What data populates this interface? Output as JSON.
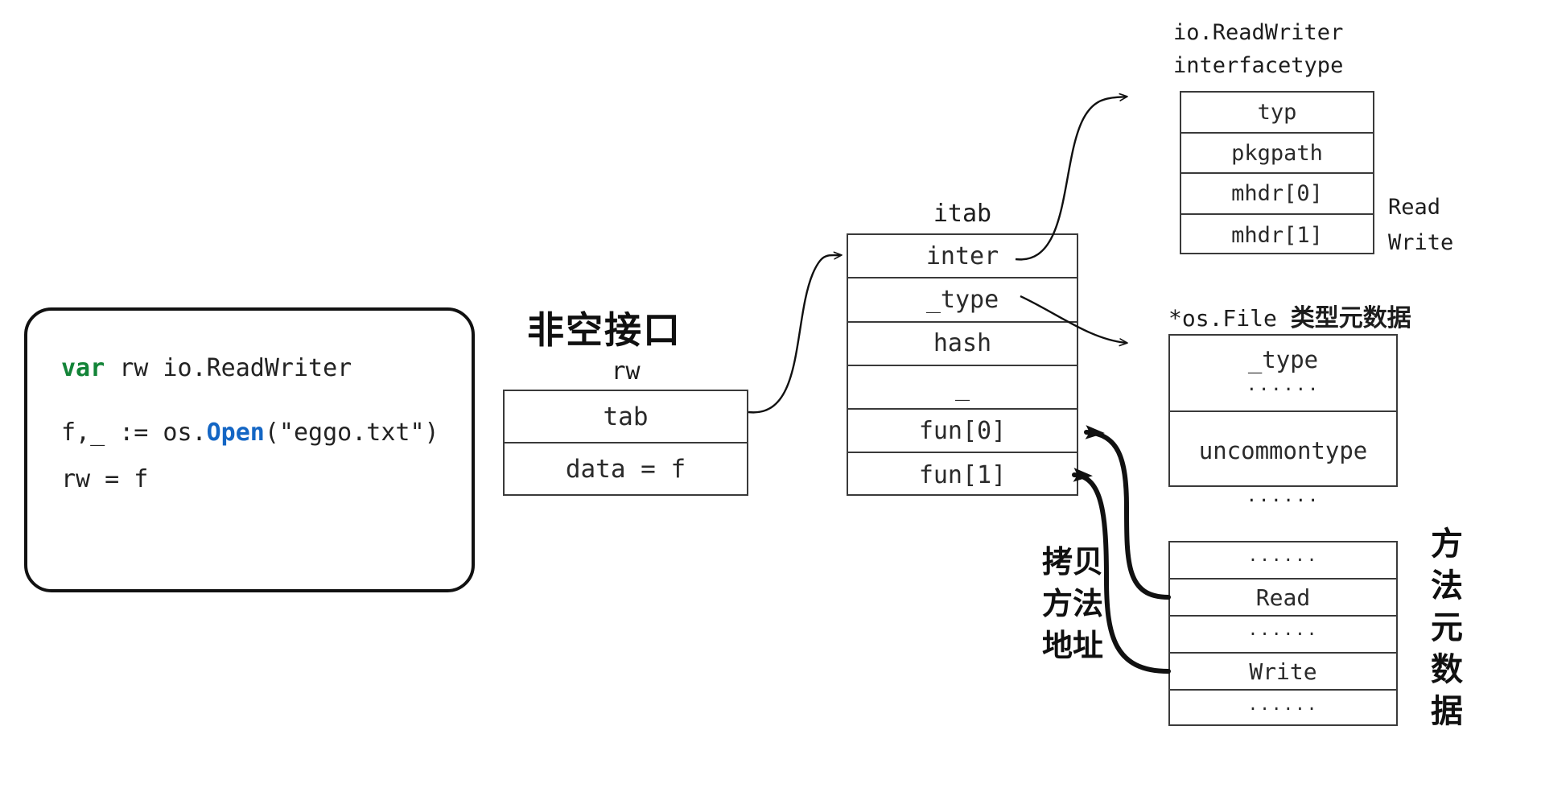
{
  "code_panel": {
    "line1_kw": "var",
    "line1_rest": " rw io.ReadWriter",
    "line2_pre": "f,_ := os.",
    "line2_fn": "Open",
    "line2_post": "(\"eggo.txt\")",
    "line3": "rw = f"
  },
  "rw": {
    "chinese_caption": "非空接口",
    "label": "rw",
    "rows": [
      "tab",
      "data = f"
    ]
  },
  "itab": {
    "label": "itab",
    "rows": [
      "inter",
      "_type",
      "hash",
      "_",
      "fun[0]",
      "fun[1]"
    ]
  },
  "interfacetype": {
    "caption_line1": "io.ReadWriter",
    "caption_line2": "interfacetype",
    "rows": [
      "typ",
      "pkgpath",
      "mhdr[0]",
      "mhdr[1]"
    ],
    "method_names": [
      "Read",
      "Write"
    ]
  },
  "osfile": {
    "caption_ascii": "*os.File ",
    "caption_han": "类型元数据",
    "rows": [
      {
        "main": "_type",
        "dots": "······"
      },
      {
        "main": "uncommontype",
        "dots": ""
      }
    ],
    "trailing_dots": "······"
  },
  "method_meta": {
    "rows": [
      "······",
      "Read",
      "······",
      "Write",
      "······"
    ],
    "chinese_vertical": "方法元数据"
  },
  "copy_addr": {
    "chinese_lines": [
      "拷贝",
      "方法",
      "地址"
    ]
  },
  "colors": {
    "keyword_green": "#138438",
    "function_blue": "#1466c4",
    "box_stroke": "#3a3a3a",
    "panel_stroke": "#111111",
    "text": "#2a2a2a",
    "background": "#ffffff"
  }
}
